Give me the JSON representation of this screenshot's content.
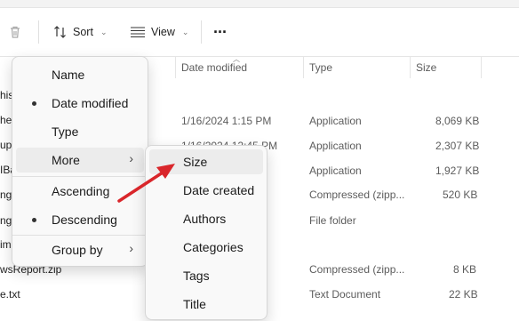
{
  "toolbar": {
    "sort_label": "Sort",
    "view_label": "View",
    "more_label": "···"
  },
  "columns": {
    "date_modified": "Date modified",
    "type": "Type",
    "size": "Size"
  },
  "left_fragments": [
    "his",
    "hel",
    "up.",
    "IBa",
    "ng_",
    "ng_",
    "im",
    "wsReport.zip",
    "e.txt"
  ],
  "rows": [
    {
      "date": "1/16/2024 1:15 PM",
      "type": "Application",
      "size": "8,069 KB"
    },
    {
      "date": "1/16/2024 12:45 PM",
      "type": "Application",
      "size": "2,307 KB"
    },
    {
      "date": "",
      "type": "Application",
      "size": "1,927 KB"
    },
    {
      "date": "",
      "type": "Compressed (zipp...",
      "size": "520 KB"
    },
    {
      "date": "",
      "type": "File folder",
      "size": ""
    },
    {
      "date": "",
      "type": "Compressed (zipp...",
      "size": "8 KB"
    },
    {
      "date": "",
      "type": "Text Document",
      "size": "22 KB"
    }
  ],
  "sort_menu": {
    "items": [
      "Name",
      "Date modified",
      "Type",
      "More",
      "Ascending",
      "Descending",
      "Group by"
    ]
  },
  "more_submenu": {
    "items": [
      "Size",
      "Date created",
      "Authors",
      "Categories",
      "Tags",
      "Title"
    ]
  },
  "colors": {
    "arrow": "#d9262b",
    "accent": "#2f6fbd"
  }
}
